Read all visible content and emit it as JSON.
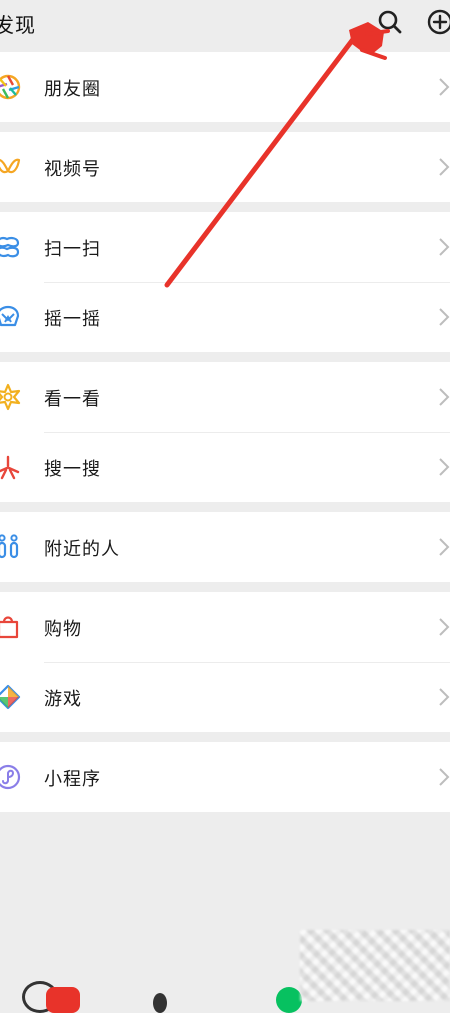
{
  "header": {
    "title": "发现",
    "icons": [
      "search-icon",
      "add-icon"
    ]
  },
  "groups": [
    [
      {
        "label": "朋友圈",
        "icon": "moments-icon"
      }
    ],
    [
      {
        "label": "视频号",
        "icon": "channels-icon"
      }
    ],
    [
      {
        "label": "扫一扫",
        "icon": "scan-icon"
      },
      {
        "label": "摇一摇",
        "icon": "shake-icon"
      }
    ],
    [
      {
        "label": "看一看",
        "icon": "top-stories-icon"
      },
      {
        "label": "搜一搜",
        "icon": "search-function-icon"
      }
    ],
    [
      {
        "label": "附近的人",
        "icon": "people-nearby-icon"
      }
    ],
    [
      {
        "label": "购物",
        "icon": "shopping-icon"
      },
      {
        "label": "游戏",
        "icon": "games-icon"
      }
    ],
    [
      {
        "label": "小程序",
        "icon": "mini-programs-icon"
      }
    ]
  ],
  "colors": {
    "background": "#ededed",
    "row": "#ffffff",
    "annotation_arrow": "#e8332a",
    "wechat_green": "#07c160"
  }
}
